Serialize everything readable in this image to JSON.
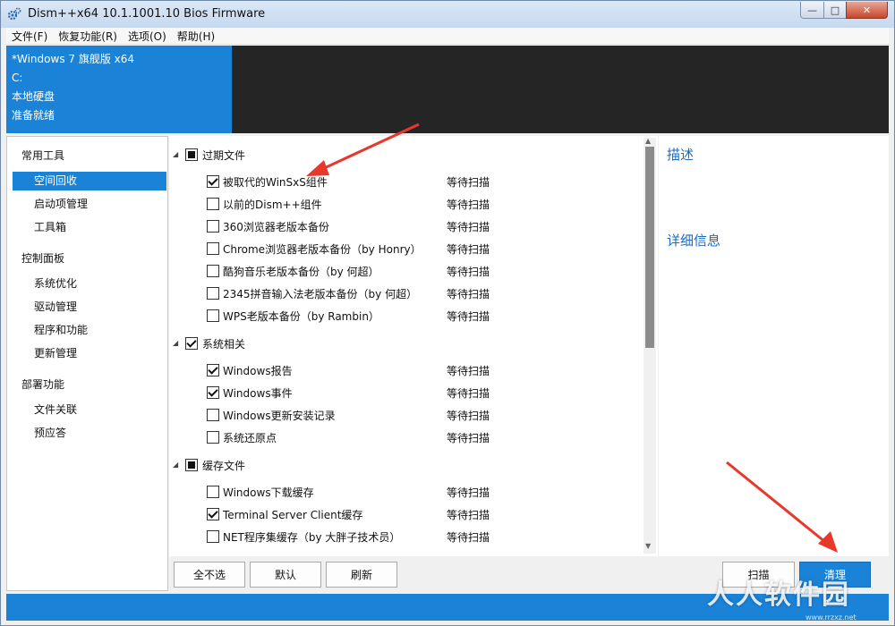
{
  "window": {
    "title": "Dism++x64 10.1.1001.10 Bios Firmware",
    "controls": {
      "minimize": "—",
      "maximize": "□",
      "close": "✕"
    }
  },
  "menu": [
    "文件(F)",
    "恢复功能(R)",
    "选项(O)",
    "帮助(H)"
  ],
  "header": {
    "lines": [
      "*Windows 7 旗舰版 x64",
      "C:",
      "本地硬盘",
      "准备就绪"
    ],
    "accent_color": "#1a83d8"
  },
  "sidebar": {
    "groups": [
      {
        "label": "常用工具",
        "items": [
          {
            "label": "空间回收",
            "selected": true
          },
          {
            "label": "启动项管理",
            "selected": false
          },
          {
            "label": "工具箱",
            "selected": false
          }
        ]
      },
      {
        "label": "控制面板",
        "items": [
          {
            "label": "系统优化",
            "selected": false
          },
          {
            "label": "驱动管理",
            "selected": false
          },
          {
            "label": "程序和功能",
            "selected": false
          },
          {
            "label": "更新管理",
            "selected": false
          }
        ]
      },
      {
        "label": "部署功能",
        "items": [
          {
            "label": "文件关联",
            "selected": false
          },
          {
            "label": "预应答",
            "selected": false
          }
        ]
      }
    ]
  },
  "cleanup": {
    "categories": [
      {
        "label": "过期文件",
        "state": "partial",
        "items": [
          {
            "label": "被取代的WinSxS组件",
            "checked": true,
            "status": "等待扫描"
          },
          {
            "label": "以前的Dism++组件",
            "checked": false,
            "status": "等待扫描"
          },
          {
            "label": "360浏览器老版本备份",
            "checked": false,
            "status": "等待扫描"
          },
          {
            "label": "Chrome浏览器老版本备份（by Honry）",
            "checked": false,
            "status": "等待扫描"
          },
          {
            "label": "酷狗音乐老版本备份（by 何超）",
            "checked": false,
            "status": "等待扫描"
          },
          {
            "label": "2345拼音输入法老版本备份（by 何超）",
            "checked": false,
            "status": "等待扫描"
          },
          {
            "label": "WPS老版本备份（by Rambin）",
            "checked": false,
            "status": "等待扫描"
          }
        ]
      },
      {
        "label": "系统相关",
        "state": "checked",
        "items": [
          {
            "label": "Windows报告",
            "checked": true,
            "status": "等待扫描"
          },
          {
            "label": "Windows事件",
            "checked": true,
            "status": "等待扫描"
          },
          {
            "label": "Windows更新安装记录",
            "checked": false,
            "status": "等待扫描"
          },
          {
            "label": "系统还原点",
            "checked": false,
            "status": "等待扫描"
          }
        ]
      },
      {
        "label": "缓存文件",
        "state": "partial",
        "items": [
          {
            "label": "Windows下载缓存",
            "checked": false,
            "status": "等待扫描"
          },
          {
            "label": "Terminal Server Client缓存",
            "checked": true,
            "status": "等待扫描"
          },
          {
            "label": "NET程序集缓存（by 大胖子技术员）",
            "checked": false,
            "status": "等待扫描"
          }
        ]
      }
    ]
  },
  "details": {
    "description_title": "描述",
    "details_title": "详细信息"
  },
  "buttons": {
    "deselect_all": "全不选",
    "default": "默认",
    "refresh": "刷新",
    "scan": "扫描",
    "clean": "清理"
  },
  "watermark": {
    "text": "人人软件园",
    "sub": "www.rrzxz.net"
  },
  "annotation_color": "#e8372b"
}
